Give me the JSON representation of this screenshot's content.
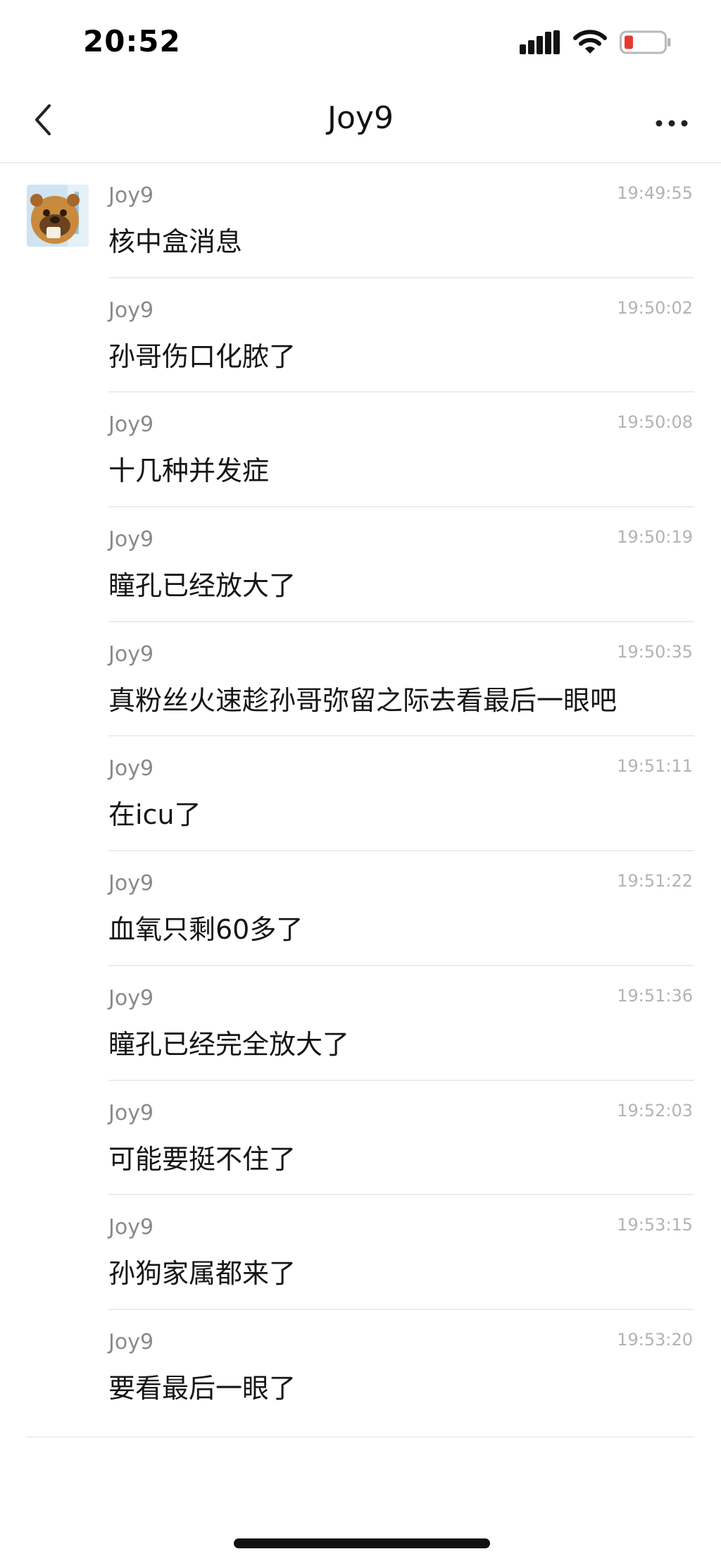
{
  "status_bar": {
    "time": "20:52",
    "icons": [
      "signal-icon",
      "wifi-icon",
      "battery-low-icon"
    ]
  },
  "header": {
    "title": "Joy9",
    "back_icon": "chevron-left-icon",
    "more_icon": "more-dots-icon"
  },
  "messages": [
    {
      "sender": "Joy9",
      "time": "19:49:55",
      "text": "核中盒消息"
    },
    {
      "sender": "Joy9",
      "time": "19:50:02",
      "text": "孙哥伤口化脓了"
    },
    {
      "sender": "Joy9",
      "time": "19:50:08",
      "text": "十几种并发症"
    },
    {
      "sender": "Joy9",
      "time": "19:50:19",
      "text": "瞳孔已经放大了"
    },
    {
      "sender": "Joy9",
      "time": "19:50:35",
      "text": "真粉丝火速趁孙哥弥留之际去看最后一眼吧"
    },
    {
      "sender": "Joy9",
      "time": "19:51:11",
      "text": "在icu了"
    },
    {
      "sender": "Joy9",
      "time": "19:51:22",
      "text": "血氧只剩60多了"
    },
    {
      "sender": "Joy9",
      "time": "19:51:36",
      "text": "瞳孔已经完全放大了"
    },
    {
      "sender": "Joy9",
      "time": "19:52:03",
      "text": "可能要挺不住了"
    },
    {
      "sender": "Joy9",
      "time": "19:53:15",
      "text": "孙狗家属都来了"
    },
    {
      "sender": "Joy9",
      "time": "19:53:20",
      "text": "要看最后一眼了"
    }
  ],
  "colors": {
    "battery_low": "#e53935",
    "sender_gray": "#8a8a8a",
    "timestamp_gray": "#b3b3b3",
    "divider": "#ececec"
  }
}
